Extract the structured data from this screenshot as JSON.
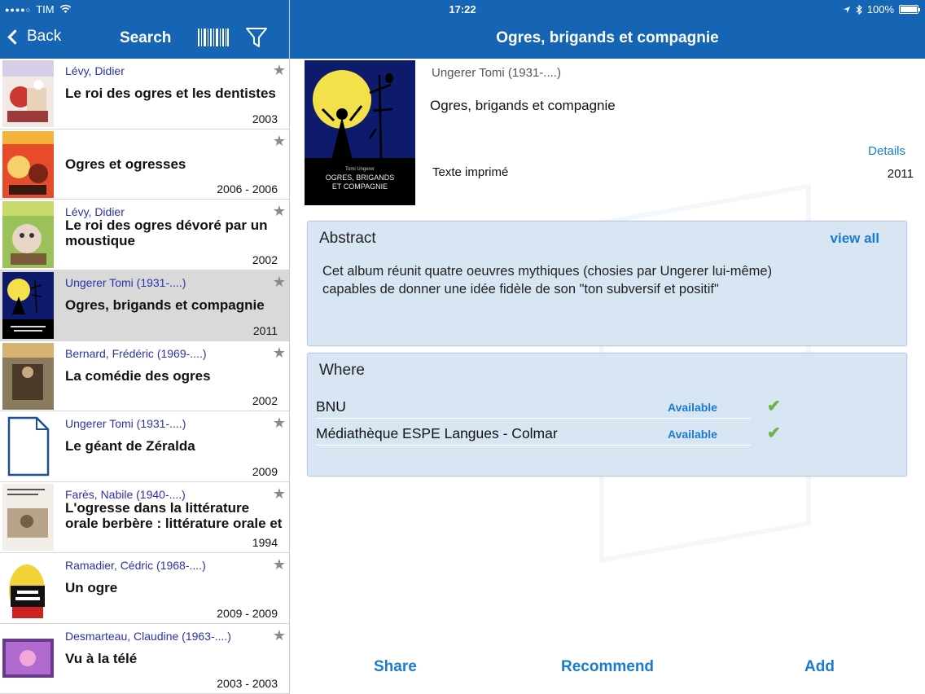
{
  "status": {
    "carrier": "TIM",
    "time": "17:22",
    "battery": "100%"
  },
  "nav": {
    "back_label": "Back",
    "search_title": "Search",
    "detail_title": "Ogres, brigands et compagnie"
  },
  "list": [
    {
      "author": "Lévy, Didier",
      "title": "Le roi des ogres et les dentistes",
      "year": "2003"
    },
    {
      "author": "",
      "title": "Ogres et ogresses",
      "year": "2006 - 2006"
    },
    {
      "author": "Lévy, Didier",
      "title": "Le roi des ogres dévoré par un moustique",
      "year": "2002"
    },
    {
      "author": "Ungerer Tomi (1931-....)",
      "title": "Ogres, brigands et compagnie",
      "year": "2011"
    },
    {
      "author": "Bernard, Frédéric (1969-....)",
      "title": "La comédie des ogres",
      "year": "2002"
    },
    {
      "author": "Ungerer Tomi (1931-....)",
      "title": "Le géant de Zéralda",
      "year": "2009"
    },
    {
      "author": "Farès, Nabile (1940-....)",
      "title": "L'ogresse dans la littérature orale berbère : littérature orale et",
      "year": "1994"
    },
    {
      "author": "Ramadier, Cédric (1968-....)",
      "title": "Un ogre",
      "year": "2009 - 2009"
    },
    {
      "author": "Desmarteau, Claudine (1963-....)",
      "title": "Vu à la télé",
      "year": "2003 - 2003"
    }
  ],
  "detail": {
    "author": "Ungerer Tomi (1931-....)",
    "title": "Ogres, brigands et compagnie",
    "details_label": "Details",
    "type": "Texte imprimé",
    "year": "2011",
    "cover_author": "Tomi Ungerer",
    "cover_title_line1": "OGRES, BRIGANDS",
    "cover_title_line2": "ET COMPAGNIE"
  },
  "abstract": {
    "heading": "Abstract",
    "view_all": "view all",
    "text": "Cet album réunit quatre oeuvres mythiques (chosies par Ungerer lui-même) capables de donner une idée fidèle de son \"ton subversif et positif\""
  },
  "where": {
    "heading": "Where",
    "locations": [
      {
        "name": "BNU",
        "status": "Available"
      },
      {
        "name": "Médiathèque ESPE Langues - Colmar",
        "status": "Available"
      }
    ]
  },
  "actions": {
    "share": "Share",
    "recommend": "Recommend",
    "add": "Add"
  },
  "colors": {
    "nav_blue": "#1565b4",
    "link_blue": "#1a7bd0",
    "author_blue": "#2b32a8",
    "panel_bg": "#d8e6f4",
    "selected_row": "#d9d9d9"
  },
  "icons": [
    "chevron-left-icon",
    "barcode-icon",
    "filter-icon",
    "star-icon",
    "checkmark-icon",
    "wifi-icon",
    "location-icon",
    "bluetooth-icon",
    "battery-icon",
    "document-icon"
  ]
}
